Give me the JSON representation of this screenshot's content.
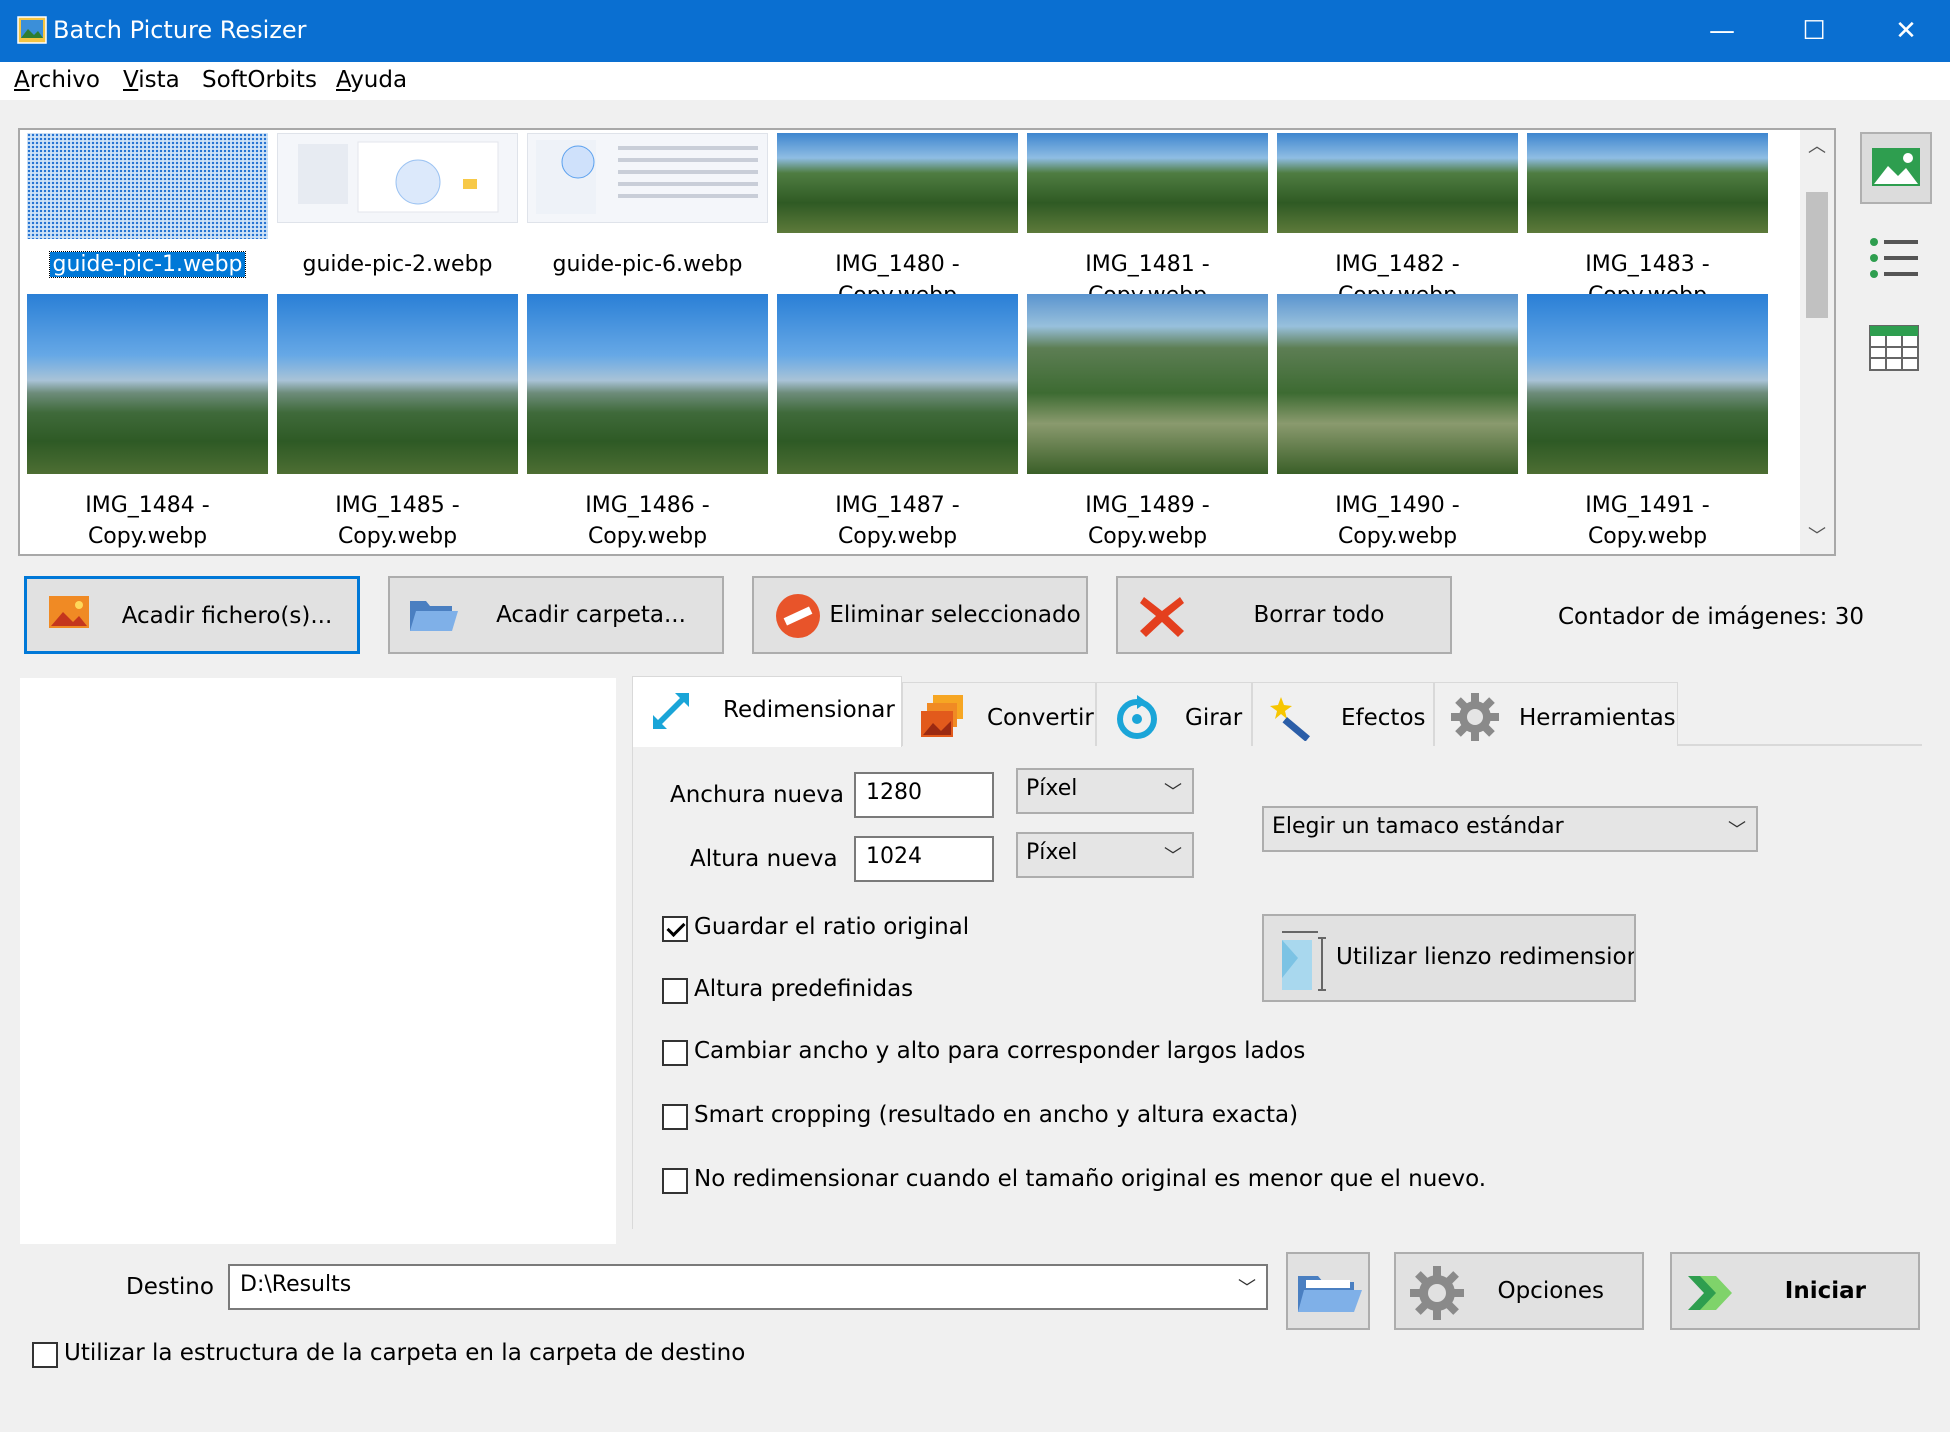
{
  "window": {
    "title": "Batch Picture Resizer",
    "minimize": "—",
    "maximize": "☐",
    "close": "✕"
  },
  "menu": [
    {
      "first": "A",
      "rest": "rchivo"
    },
    {
      "first": "V",
      "rest": "ista"
    },
    {
      "first": "",
      "rest": "SoftOrbits"
    },
    {
      "first": "A",
      "rest": "yuda"
    }
  ],
  "thumbnails": [
    {
      "line1": "guide-pic-1.webp",
      "line2": ""
    },
    {
      "line1": "guide-pic-2.webp",
      "line2": ""
    },
    {
      "line1": "guide-pic-6.webp",
      "line2": ""
    },
    {
      "line1": "IMG_1480 -",
      "line2": "Copy.webp"
    },
    {
      "line1": "IMG_1481 -",
      "line2": "Copy.webp"
    },
    {
      "line1": "IMG_1482 -",
      "line2": "Copy.webp"
    },
    {
      "line1": "IMG_1483 -",
      "line2": "Copy.webp"
    },
    {
      "line1": "IMG_1484 -",
      "line2": "Copy.webp"
    },
    {
      "line1": "IMG_1485 -",
      "line2": "Copy.webp"
    },
    {
      "line1": "IMG_1486 -",
      "line2": "Copy.webp"
    },
    {
      "line1": "IMG_1487 -",
      "line2": "Copy.webp"
    },
    {
      "line1": "IMG_1489 -",
      "line2": "Copy.webp"
    },
    {
      "line1": "IMG_1490 -",
      "line2": "Copy.webp"
    },
    {
      "line1": "IMG_1491 -",
      "line2": "Copy.webp"
    }
  ],
  "actions": {
    "add_files": "Acadir fichero(s)...",
    "add_folder": "Acadir carpeta...",
    "remove_selected": "Eliminar seleccionado",
    "clear_all": "Borrar todo",
    "counter": "Contador de imágenes: 30"
  },
  "tabs": [
    "Redimensionar",
    "Convertir",
    "Girar",
    "Efectos",
    "Herramientas"
  ],
  "resize": {
    "width_label": "Anchura nueva",
    "width_value": "1280",
    "width_unit": "Píxel",
    "height_label": "Altura nueva",
    "height_value": "1024",
    "height_unit": "Píxel",
    "standard_size": "Elegir un tamaco estándar",
    "keep_ratio": "Guardar el ratio original",
    "predefined_height": "Altura predefinidas",
    "swap_sides": "Cambiar ancho y alto para corresponder largos lados",
    "smart_crop": "Smart cropping (resultado en ancho y altura exacta)",
    "no_upscale": "No redimensionar cuando el tamaño original es menor que el nuevo.",
    "canvas_resize": "Utilizar lienzo redimensionar"
  },
  "bottom": {
    "dest_label": "Destino",
    "dest_value": "D:\\Results",
    "options": "Opciones",
    "start": "Iniciar",
    "folder_structure": "Utilizar la estructura de la carpeta en la carpeta de destino"
  },
  "colors": {
    "titlebar": "#0a6fd1",
    "selection": "#0078d7",
    "button_face": "#e1e1e1"
  }
}
